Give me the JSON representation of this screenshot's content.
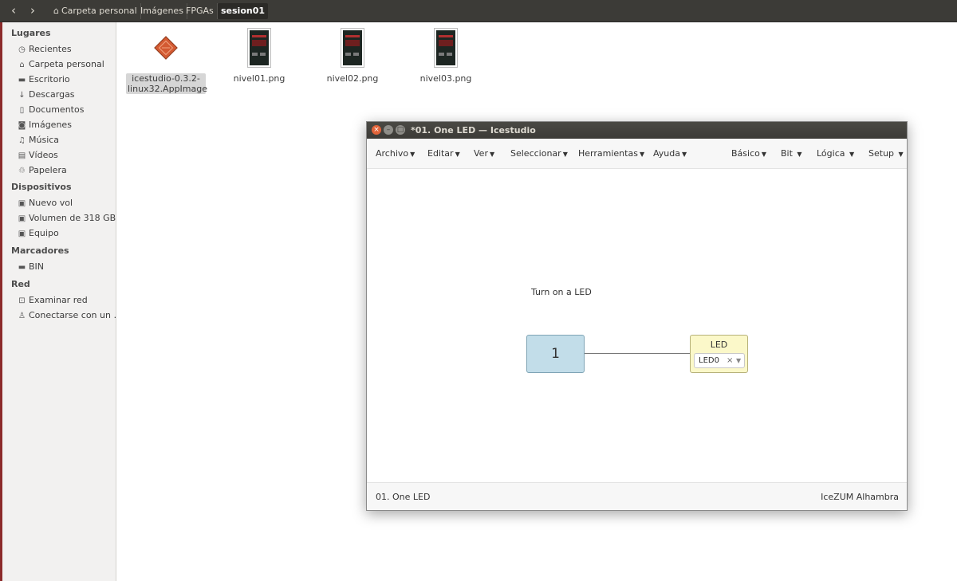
{
  "toolbar": {
    "back_icon": "chevron-left-icon",
    "forward_icon": "chevron-right-icon",
    "breadcrumbs": [
      "Carpeta personal",
      "Imágenes",
      "FPGAs",
      "sesion01"
    ]
  },
  "sidebar": {
    "sections": [
      {
        "title": "Lugares",
        "items": [
          {
            "label": "Recientes",
            "icon": "clock-icon"
          },
          {
            "label": "Carpeta personal",
            "icon": "home-icon"
          },
          {
            "label": "Escritorio",
            "icon": "folder-icon"
          },
          {
            "label": "Descargas",
            "icon": "download-icon"
          },
          {
            "label": "Documentos",
            "icon": "document-icon"
          },
          {
            "label": "Imágenes",
            "icon": "camera-icon"
          },
          {
            "label": "Música",
            "icon": "music-icon"
          },
          {
            "label": "Vídeos",
            "icon": "film-icon"
          },
          {
            "label": "Papelera",
            "icon": "trash-icon"
          }
        ]
      },
      {
        "title": "Dispositivos",
        "items": [
          {
            "label": "Nuevo vol",
            "icon": "drive-icon"
          },
          {
            "label": "Volumen de 318 GB",
            "icon": "drive-icon"
          },
          {
            "label": "Equipo",
            "icon": "drive-icon"
          }
        ]
      },
      {
        "title": "Marcadores",
        "items": [
          {
            "label": "BIN",
            "icon": "folder-icon"
          }
        ]
      },
      {
        "title": "Red",
        "items": [
          {
            "label": "Examinar red",
            "icon": "network-icon"
          },
          {
            "label": "Conectarse con un …",
            "icon": "server-icon"
          }
        ]
      }
    ]
  },
  "files": [
    {
      "label": "icestudio-0.3.2-linux32.AppImage",
      "type": "appimage",
      "selected": true
    },
    {
      "label": "nivel01.png",
      "type": "png"
    },
    {
      "label": "nivel02.png",
      "type": "png"
    },
    {
      "label": "nivel03.png",
      "type": "png"
    }
  ],
  "icestudio": {
    "title": "*01. One LED — Icestudio",
    "menu_left": [
      "Archivo",
      "Editar",
      "Ver",
      "Seleccionar",
      "Herramientas",
      "Ayuda"
    ],
    "menu_right": [
      "Básico",
      "Bit",
      "Lógica",
      "Setup"
    ],
    "canvas": {
      "comment": "Turn on a LED",
      "constant_value": "1",
      "led_block_title": "LED",
      "led_select_value": "LED0",
      "led_clear_glyph": "×"
    },
    "footer_left": "01. One LED",
    "footer_right": "IceZUM Alhambra"
  },
  "colors": {
    "toolbar_bg": "#3c3b37",
    "sidebar_bg": "#f2f1f0",
    "close_button": "#e2643a",
    "constant_block": "#c2dde9",
    "led_block": "#fbf8c9",
    "appimage_icon": "#d35a32"
  }
}
